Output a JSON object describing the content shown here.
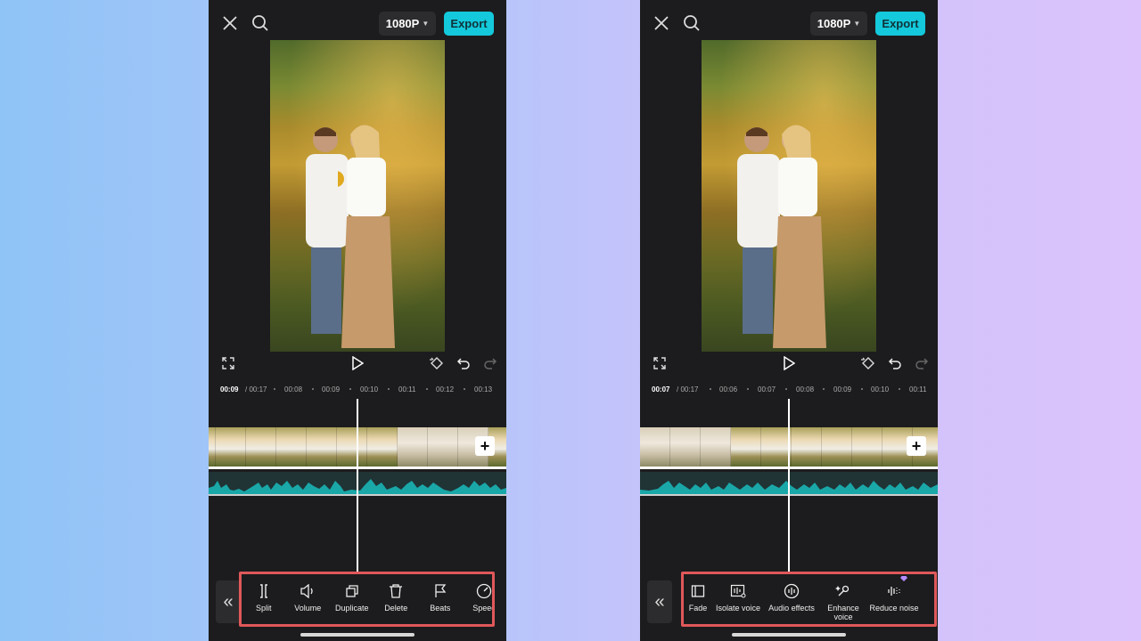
{
  "left": {
    "resolution": "1080P",
    "export_label": "Export",
    "ruler": {
      "current": "00:09",
      "total": "/ 00:17",
      "ticks": [
        "00:08",
        "00:09",
        "00:10",
        "00:11",
        "00:12",
        "00:13"
      ]
    },
    "tools": [
      {
        "label": "Split",
        "icon": "split-icon"
      },
      {
        "label": "Volume",
        "icon": "volume-icon"
      },
      {
        "label": "Duplicate",
        "icon": "duplicate-icon"
      },
      {
        "label": "Delete",
        "icon": "delete-icon"
      },
      {
        "label": "Beats",
        "icon": "beats-flag-icon"
      },
      {
        "label": "Speed",
        "icon": "speed-icon"
      }
    ]
  },
  "right": {
    "resolution": "1080P",
    "export_label": "Export",
    "ruler": {
      "current": "00:07",
      "total": "/ 00:17",
      "ticks": [
        "00:06",
        "00:07",
        "00:08",
        "00:09",
        "00:10",
        "00:11"
      ]
    },
    "tools": [
      {
        "label": "Fade",
        "icon": "fade-icon"
      },
      {
        "label": "Isolate voice",
        "icon": "isolate-voice-icon"
      },
      {
        "label": "Audio effects",
        "icon": "audio-effects-icon"
      },
      {
        "label": "Enhance voice",
        "icon": "enhance-voice-icon"
      },
      {
        "label": "Reduce noise",
        "icon": "reduce-noise-icon"
      }
    ]
  },
  "colors": {
    "accent": "#13c9db",
    "highlight_border": "#e0585a",
    "audio_wave": "#1aa7a8",
    "panel": "#1c1c1e"
  }
}
